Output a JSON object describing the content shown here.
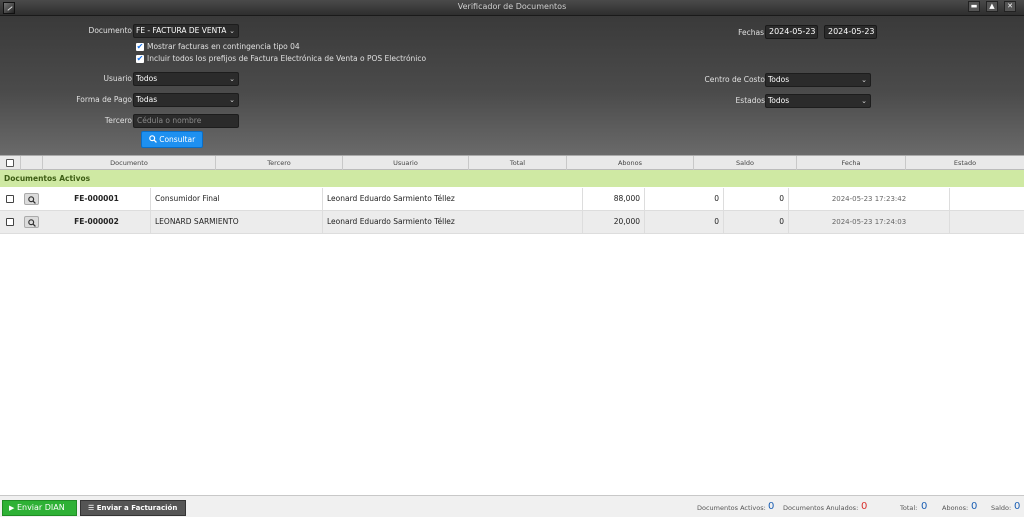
{
  "window": {
    "title": "Verificador de Documentos"
  },
  "filters": {
    "documento_label": "Documento",
    "documento_value": "FE - FACTURA DE VENTA",
    "check1": "Mostrar facturas en contingencia tipo 04",
    "check2": "Incluir todos los prefijos de Factura Electrónica de Venta o POS Electrónico",
    "usuario_label": "Usuario",
    "usuario_value": "Todos",
    "forma_pago_label": "Forma de Pago",
    "forma_pago_value": "Todas",
    "tercero_label": "Tercero",
    "tercero_placeholder": "Cédula o nombre",
    "consultar_label": "Consultar",
    "fechas_label": "Fechas",
    "fecha_desde": "2024-05-23",
    "fecha_hasta": "2024-05-23",
    "centro_costo_label": "Centro de Costo",
    "centro_costo_value": "Todos",
    "estados_label": "Estados",
    "estados_value": "Todos"
  },
  "grid": {
    "headers": [
      "Documento",
      "Tercero",
      "Usuario",
      "Total",
      "Abonos",
      "Saldo",
      "Fecha",
      "Estado"
    ],
    "group_label": "Documentos Activos",
    "rows": [
      {
        "documento": "FE-000001",
        "tercero": "Consumidor Final",
        "usuario": "Leonard Eduardo Sarmiento Téllez",
        "total": "88,000",
        "abonos": "0",
        "saldo": "0",
        "fecha": "2024-05-23 17:23:42",
        "estado": ""
      },
      {
        "documento": "FE-000002",
        "tercero": "LEONARD SARMIENTO",
        "usuario": "Leonard Eduardo Sarmiento Téllez",
        "total": "20,000",
        "abonos": "0",
        "saldo": "0",
        "fecha": "2024-05-23 17:24:03",
        "estado": ""
      }
    ]
  },
  "status": {
    "enviar_dian": "Enviar DIAN",
    "enviar_facturacion": "Enviar a Facturación",
    "activos_label": "Documentos Activos:",
    "activos_value": "0",
    "anulados_label": "Documentos Anulados:",
    "anulados_value": "0",
    "total_label": "Total:",
    "total_value": "0",
    "abonos_label": "Abonos:",
    "abonos_value": "0",
    "saldo_label": "Saldo:",
    "saldo_value": "0"
  },
  "colors": {
    "accent": "#1e90f0",
    "group_bg": "#cfe9a3",
    "dian_green": "#2eb135",
    "anulados_red": "#d9302c",
    "value_blue": "#1a5fb4"
  }
}
